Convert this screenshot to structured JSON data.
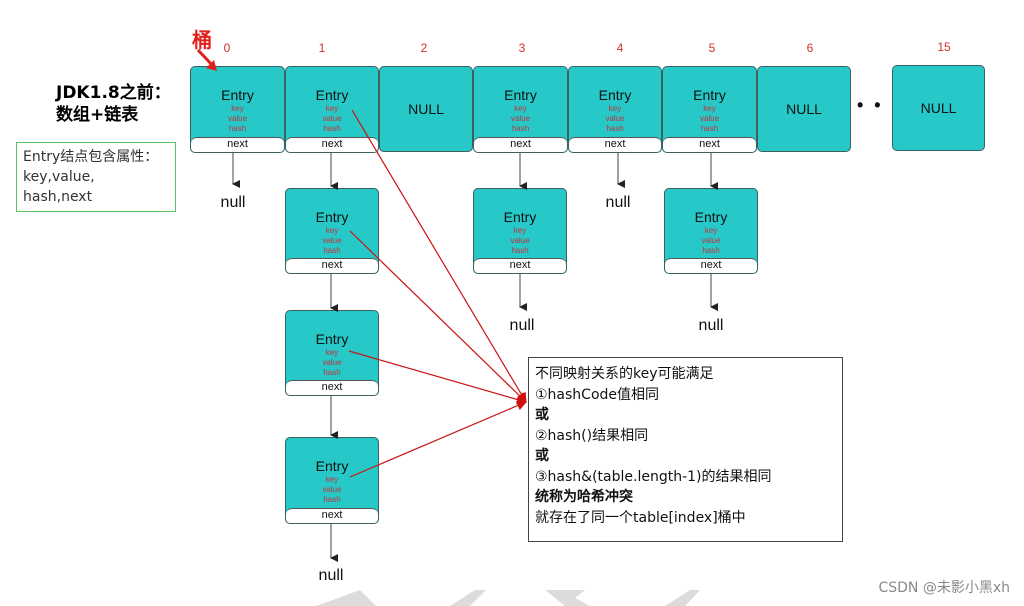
{
  "title": {
    "line1": "JDK1.8之前：",
    "line2": "数组+链表"
  },
  "bucket_label": "桶",
  "attributes_box": {
    "line1": "Entry结点包含属性：",
    "line2": "key,value,",
    "line3": "hash,next"
  },
  "colors": {
    "cell_fill": "#26c8c8",
    "field_text": "#c0343c",
    "index_text": "#d0312d",
    "collision_arrow": "#c81414",
    "attr_box_border": "#5cc45a"
  },
  "entry": {
    "name": "Entry",
    "fields": [
      "key",
      "value",
      "hash"
    ],
    "next": "next"
  },
  "null_cell_label": "NULL",
  "null_text": "null",
  "ellipsis": "• • •",
  "table": [
    {
      "index": "0",
      "type": "entry",
      "chain_length": 1
    },
    {
      "index": "1",
      "type": "entry",
      "chain_length": 4
    },
    {
      "index": "2",
      "type": "null"
    },
    {
      "index": "3",
      "type": "entry",
      "chain_length": 2
    },
    {
      "index": "4",
      "type": "entry",
      "chain_length": 1
    },
    {
      "index": "5",
      "type": "entry",
      "chain_length": 2
    },
    {
      "index": "6",
      "type": "null"
    },
    {
      "index": "15",
      "type": "null"
    }
  ],
  "note": {
    "lines": [
      {
        "text": "不同映射关系的key可能满足",
        "bold": false
      },
      {
        "text": "①hashCode值相同",
        "bold": false
      },
      {
        "text": "或",
        "bold": true
      },
      {
        "text": "②hash()结果相同",
        "bold": false
      },
      {
        "text": "或",
        "bold": true
      },
      {
        "text": "③hash&(table.length-1)的结果相同",
        "bold": false
      },
      {
        "text": "统称为哈希冲突",
        "bold": true
      },
      {
        "text": "就存在了同一个table[index]桶中",
        "bold": false
      }
    ]
  },
  "watermark": "CSDN @未影小黑xh"
}
